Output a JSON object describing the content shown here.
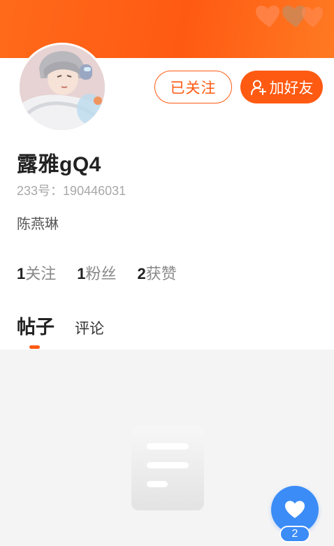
{
  "profile": {
    "username": "露雅gQ4",
    "uid_label": "233号：",
    "uid_value": "190446031",
    "signature": "陈燕琳"
  },
  "actions": {
    "following_label": "已关注",
    "add_friend_label": "加好友"
  },
  "stats": [
    {
      "value": "1",
      "label": "关注"
    },
    {
      "value": "1",
      "label": "粉丝"
    },
    {
      "value": "2",
      "label": "获赞"
    }
  ],
  "tabs": {
    "posts": "帖子",
    "comments": "评论",
    "active": "帖子"
  },
  "like_fab": {
    "count": "2",
    "icon": "heart-icon"
  },
  "colors": {
    "accent": "#ff5a12",
    "like_blue": "#3b8cf6",
    "content_bg": "#f4f4f4"
  },
  "icons": {
    "add_friend": "person-plus-icon",
    "header_decoration": "heart-icon",
    "empty_state": "document-icon"
  }
}
